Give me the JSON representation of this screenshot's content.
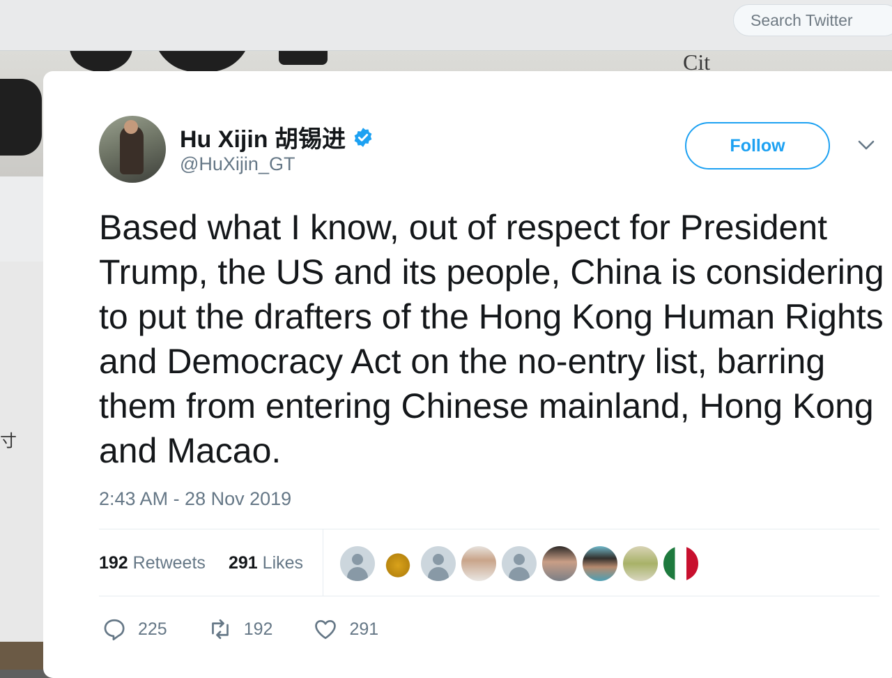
{
  "topbar": {
    "search_placeholder": "Search Twitter"
  },
  "background": {
    "banner_text": "Cit",
    "side_char": "寸"
  },
  "tweet": {
    "author_name": "Hu Xijin 胡锡进",
    "verified": true,
    "handle": "@HuXijin_GT",
    "follow_label": "Follow",
    "text": "Based what I know, out of respect for President Trump, the US and its people, China is considering to put the drafters of the Hong Kong Human Rights and Democracy Act on the no-entry list, barring them from entering Chinese mainland, Hong Kong and Macao.",
    "timestamp": "2:43 AM - 28 Nov 2019",
    "stats": {
      "retweets_count": "192",
      "retweets_label": "Retweets",
      "likes_count": "291",
      "likes_label": "Likes"
    },
    "likers": [
      "default-avatar",
      "gold-avatar",
      "default-avatar",
      "man-avatar",
      "default-avatar",
      "man2-avatar",
      "man3-avatar",
      "yellow-avatar",
      "flag-avatar"
    ],
    "actions": {
      "reply_count": "225",
      "retweet_count": "192",
      "like_count": "291"
    }
  },
  "colors": {
    "accent": "#1da1f2",
    "text": "#14171a",
    "secondary": "#657786"
  }
}
